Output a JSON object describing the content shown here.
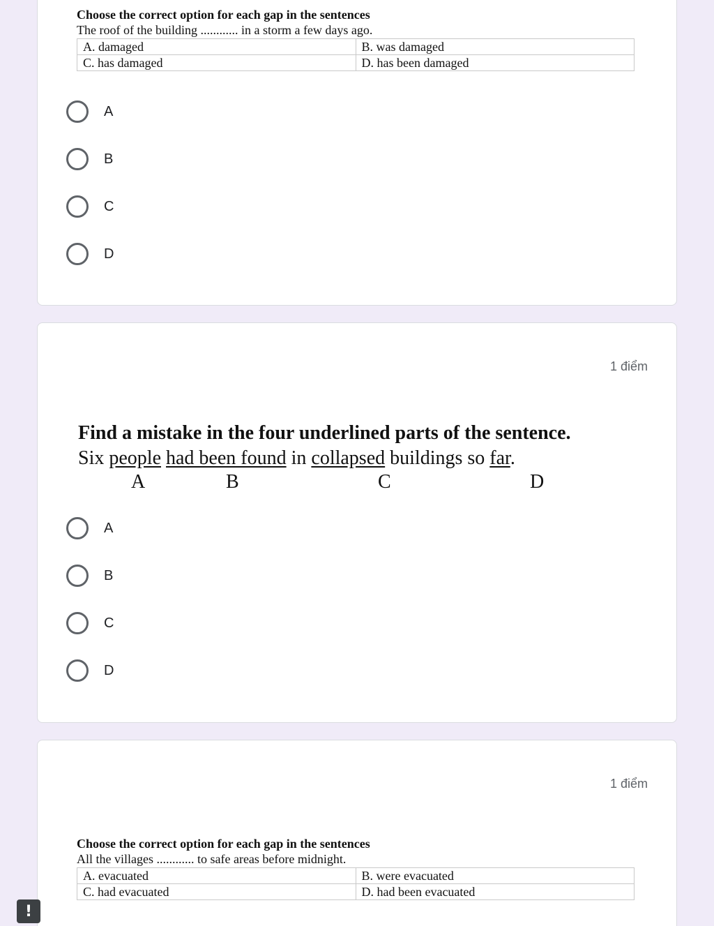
{
  "q1": {
    "heading": "Choose the correct option for each gap in the sentences",
    "sentence": "The roof of the building ............ in a storm a few days ago.",
    "table": [
      [
        "A. damaged",
        "B. was damaged"
      ],
      [
        "C. has damaged",
        "D. has been damaged"
      ]
    ],
    "choices": [
      "A",
      "B",
      "C",
      "D"
    ]
  },
  "q2": {
    "points": "1 điểm",
    "heading": "Find a mistake in the four underlined parts of the sentence.",
    "sentence_parts": {
      "w1": "Six ",
      "u1": "people",
      "w2": " ",
      "u2": "had been found",
      "w3": " in ",
      "u3": "collapsed",
      "w4": " buildings so ",
      "u4": "far",
      "w5": "."
    },
    "letters": [
      "A",
      "B",
      "C",
      "D"
    ],
    "choices": [
      "A",
      "B",
      "C",
      "D"
    ]
  },
  "q3": {
    "points": "1 điểm",
    "heading": "Choose the correct option for each gap in the sentences",
    "sentence": "All the villages ............ to safe areas before midnight.",
    "table": [
      [
        "A. evacuated",
        "B. were evacuated"
      ],
      [
        "C. had evacuated",
        "D. had been evacuated"
      ]
    ]
  },
  "alert": {
    "symbol": "!",
    "icon": "alert-icon"
  }
}
